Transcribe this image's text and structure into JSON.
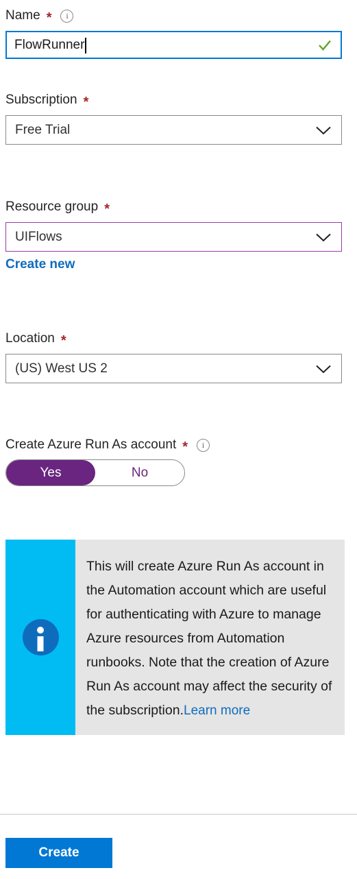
{
  "form": {
    "name_field": {
      "label": "Name",
      "required_marker": "*",
      "info_icon": "info-icon",
      "value": "FlowRunner",
      "validation_icon": "green-checkmark-icon"
    },
    "subscription_field": {
      "label": "Subscription",
      "required_marker": "*",
      "value": "Free Trial",
      "dropdown_icon": "chevron-down-icon"
    },
    "resource_group_field": {
      "label": "Resource group",
      "required_marker": "*",
      "value": "UIFlows",
      "dropdown_icon": "chevron-down-icon",
      "create_new_link": "Create new"
    },
    "location_field": {
      "label": "Location",
      "required_marker": "*",
      "value": "(US) West US 2",
      "dropdown_icon": "chevron-down-icon"
    },
    "run_as_field": {
      "label": "Create Azure Run As account",
      "required_marker": "*",
      "info_icon": "info-icon",
      "option_yes": "Yes",
      "option_no": "No",
      "selected": "Yes"
    },
    "info_banner": {
      "icon": "info-circle-icon",
      "text": "This will create Azure Run As account in the Automation account which are useful for authenticating with Azure to manage Azure resources from Automation runbooks. Note that the creation of Azure Run As account may affect the security of the subscription.",
      "link": "Learn more"
    },
    "submit_button": "Create"
  },
  "colors": {
    "accent_blue": "#0078d4",
    "link_blue": "#0f6cbd",
    "required_red": "#a4262c",
    "purple": "#69257f",
    "resource_group_border": "#9b38a8",
    "banner_stripe": "#00bcf2",
    "banner_background": "#e5e5e5",
    "valid_green": "#5ea624"
  }
}
